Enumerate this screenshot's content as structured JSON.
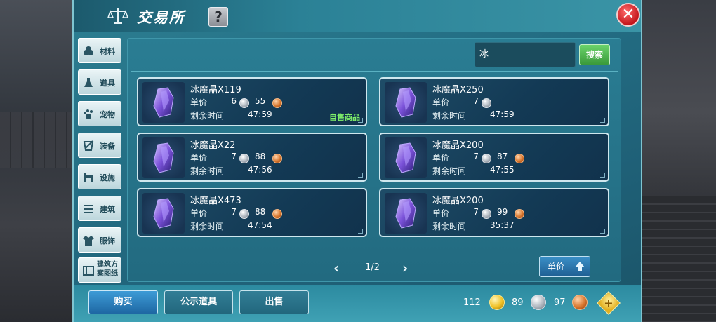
{
  "header": {
    "title": "交易所",
    "help_label": "?",
    "close_label": "✕"
  },
  "sidebar": {
    "items": [
      {
        "label": "材料",
        "icon": "materials-icon"
      },
      {
        "label": "道具",
        "icon": "potion-icon"
      },
      {
        "label": "宠物",
        "icon": "paw-icon"
      },
      {
        "label": "装备",
        "icon": "armor-icon"
      },
      {
        "label": "设施",
        "icon": "facility-icon"
      },
      {
        "label": "建筑",
        "icon": "building-icon"
      },
      {
        "label": "服饰",
        "icon": "clothing-icon"
      },
      {
        "label": "建筑方案图纸",
        "icon": "blueprint-icon"
      }
    ]
  },
  "search": {
    "value": "冰",
    "button_label": "搜索"
  },
  "labels": {
    "unit_price": "单价",
    "time_left": "剩余时间"
  },
  "listings": [
    {
      "name": "冰魔晶X119",
      "silver": "6",
      "copper": "55",
      "time": "47:59",
      "tag": "自售商品"
    },
    {
      "name": "冰魔晶X250",
      "silver": "7",
      "copper": "",
      "time": "47:59",
      "tag": ""
    },
    {
      "name": "冰魔晶X22",
      "silver": "7",
      "copper": "88",
      "time": "47:56",
      "tag": ""
    },
    {
      "name": "冰魔晶X200",
      "silver": "7",
      "copper": "87",
      "time": "47:55",
      "tag": ""
    },
    {
      "name": "冰魔晶X473",
      "silver": "7",
      "copper": "88",
      "time": "47:54",
      "tag": ""
    },
    {
      "name": "冰魔晶X200",
      "silver": "7",
      "copper": "99",
      "time": "35:37",
      "tag": ""
    }
  ],
  "pagination": {
    "text": "1/2"
  },
  "sort": {
    "label": "单价"
  },
  "actions": {
    "buy": "购买",
    "publish": "公示道具",
    "sell": "出售"
  },
  "currency": {
    "gold": "112",
    "silver": "89",
    "copper": "97",
    "plus_label": "+"
  }
}
